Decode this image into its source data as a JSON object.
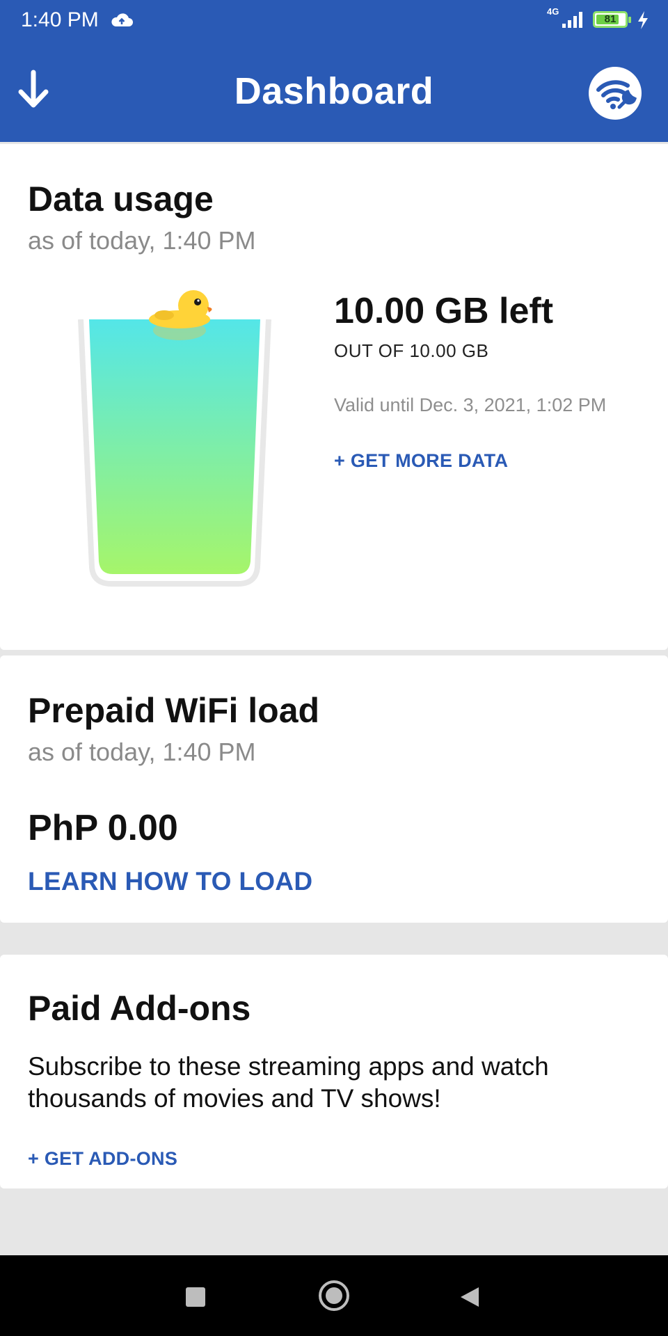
{
  "status_bar": {
    "time": "1:40 PM",
    "network": "4G",
    "battery": "81",
    "battery_level": 0.81
  },
  "app_bar": {
    "title": "Dashboard",
    "left_icon": "download-arrow-icon",
    "right_icon": "wifi-wrench-icon"
  },
  "data_usage": {
    "title": "Data usage",
    "subtitle": "as of today, 1:40 PM",
    "left": "10.00 GB left",
    "out_of": "OUT OF 10.00 GB",
    "valid_until": "Valid until Dec. 3, 2021, 1:02 PM",
    "get_more_label": "+ GET MORE DATA",
    "fill_fraction": 1.0
  },
  "prepaid_wifi": {
    "title": "Prepaid WiFi load",
    "subtitle": "as of today, 1:40 PM",
    "balance": "PhP 0.00",
    "learn_label": "LEARN HOW TO LOAD"
  },
  "paid_addons": {
    "title": "Paid Add-ons",
    "description": "Subscribe to these streaming apps and watch thousands of movies and TV shows!",
    "get_label": "+ GET ADD-ONS"
  },
  "nav_bar": {
    "icons": [
      "recents-square-icon",
      "home-circle-icon",
      "back-triangle-icon"
    ]
  },
  "colors": {
    "primary": "#2a5ab5",
    "link": "#2a5ab5",
    "liquid_top": "#54e6e8",
    "liquid_bottom": "#a6f56a",
    "duck": "#ffd338"
  }
}
